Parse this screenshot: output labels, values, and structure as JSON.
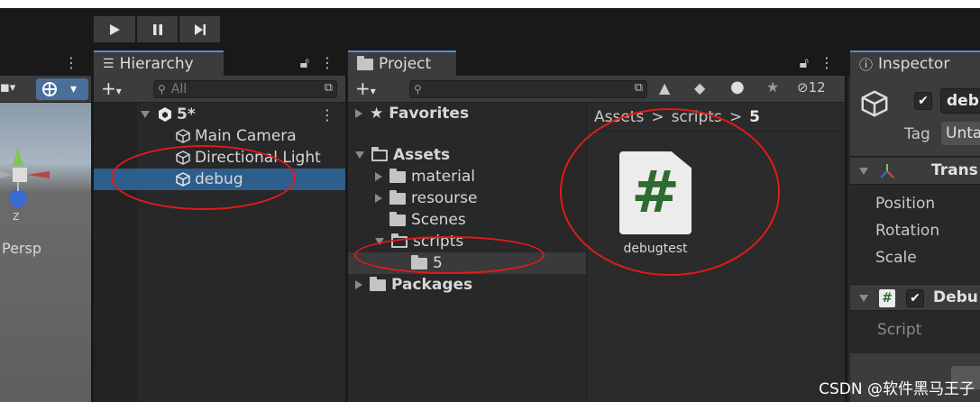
{
  "toolbar": {
    "play_icon": "play-icon",
    "pause_icon": "pause-icon",
    "step_icon": "step-icon"
  },
  "scene_view": {
    "gizmo_label": "Persp",
    "axis_label": "z"
  },
  "hierarchy": {
    "tab_label": "Hierarchy",
    "search_placeholder": "All",
    "scene_name": "5*",
    "items": [
      {
        "label": "Main Camera"
      },
      {
        "label": "Directional Light"
      },
      {
        "label": "debug"
      }
    ]
  },
  "project": {
    "tab_label": "Project",
    "hidden_count": "12",
    "tree": {
      "favorites": "Favorites",
      "assets": "Assets",
      "folders": [
        "material",
        "resourse",
        "Scenes",
        "scripts"
      ],
      "subfolder": "5",
      "packages": "Packages"
    },
    "breadcrumb": [
      "Assets",
      ">",
      "scripts",
      ">",
      "5"
    ],
    "asset": {
      "name": "debugtest",
      "glyph": "#"
    }
  },
  "inspector": {
    "tab_label": "Inspector",
    "object_name": "debu",
    "tag_label": "Tag",
    "tag_value": "Unta",
    "transform_label": "Trans",
    "fields": [
      "Position",
      "Rotation",
      "Scale"
    ],
    "component_label": "Debu",
    "script_label": "Script"
  },
  "watermark": "CSDN @软件黑马王子",
  "colors": {
    "selection": "#2d5e8d",
    "annotation": "#e01b1b",
    "script_green": "#2e6b2e"
  }
}
